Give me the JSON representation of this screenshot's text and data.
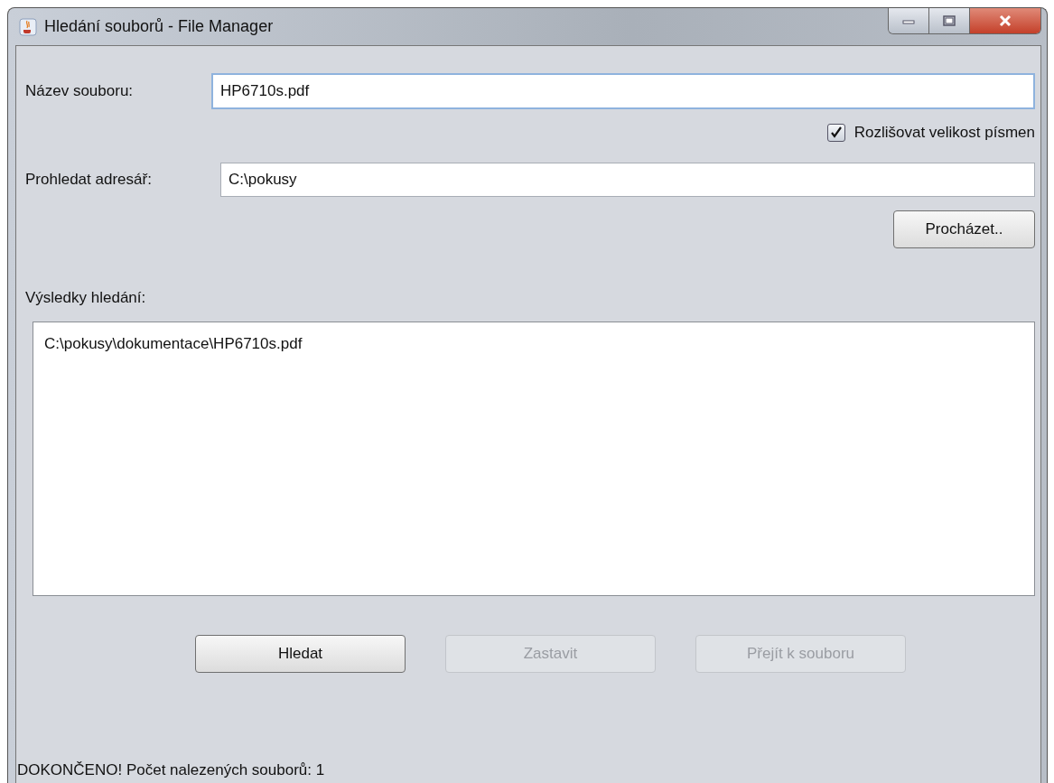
{
  "window": {
    "title": "Hledání souborů - File Manager"
  },
  "file_name": {
    "label": "Název souboru:",
    "value": "HP6710s.pdf",
    "focused": true
  },
  "case_sensitive": {
    "label": "Rozlišovat velikost písmen",
    "checked": true
  },
  "directory": {
    "label": "Prohledat adresář:",
    "value": "C:\\pokusy"
  },
  "browse_button": {
    "label": "Procházet..",
    "disabled": false
  },
  "results": {
    "label": "Výsledky hledání:",
    "items": [
      "C:\\pokusy\\dokumentace\\HP6710s.pdf"
    ]
  },
  "buttons": [
    {
      "label": "Hledat",
      "disabled": false
    },
    {
      "label": "Zastavit",
      "disabled": true
    },
    {
      "label": "Přejít k souboru",
      "disabled": true
    }
  ],
  "status_bar": "DOKONČENO! Počet nalezených souborů: 1"
}
